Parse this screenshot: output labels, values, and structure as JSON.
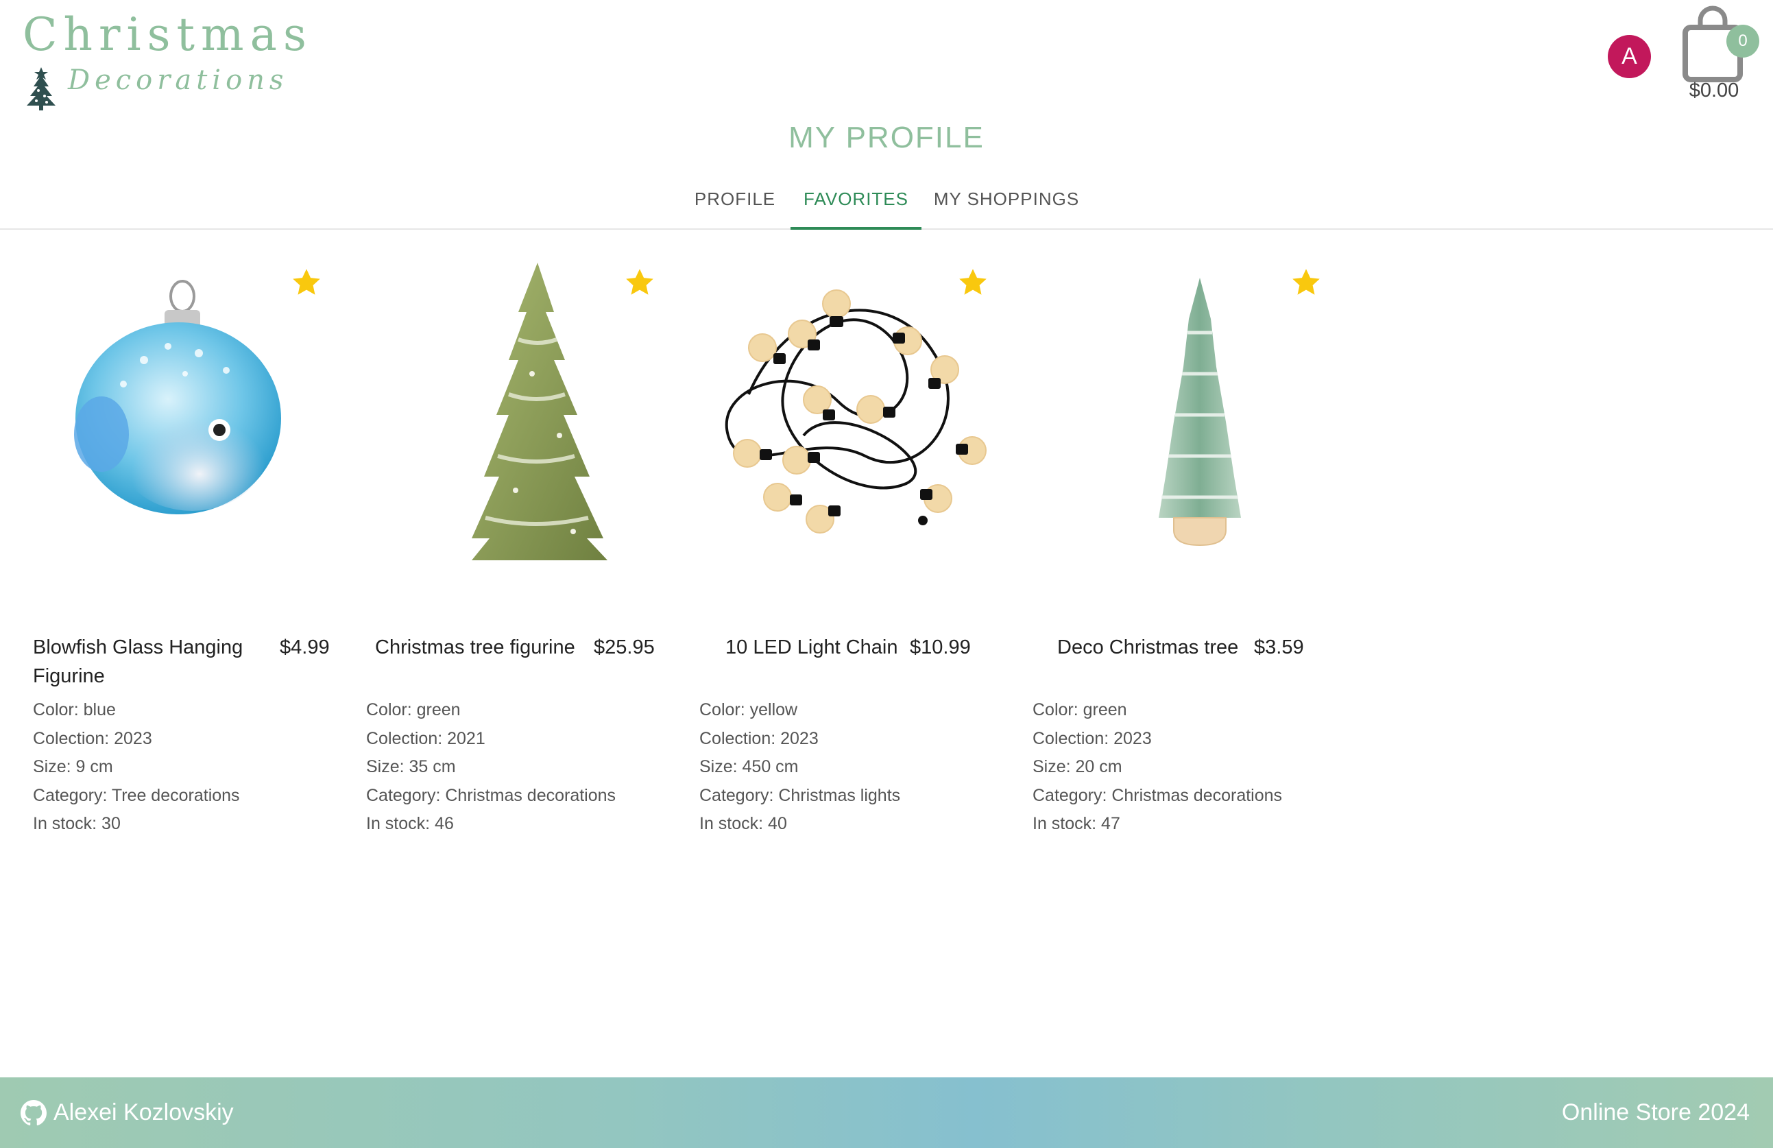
{
  "header": {
    "logo": {
      "title": "Christmas",
      "subtitle": "Decorations",
      "icon": "christmas-tree-icon"
    },
    "avatar_letter": "A",
    "avatar_color": "#c2185b",
    "cart": {
      "count": "0",
      "total": "$0.00",
      "icon": "shopping-bag-icon"
    }
  },
  "page_title": "MY PROFILE",
  "tabs": [
    {
      "label": "PROFILE",
      "active": false
    },
    {
      "label": "FAVORITES",
      "active": true
    },
    {
      "label": "MY SHOPPINGS",
      "active": false
    }
  ],
  "products": [
    {
      "name_line1": "Blowfish Glass Hanging",
      "name_line2": "Figurine",
      "price": "$4.99",
      "color": "Color: blue",
      "collection": "Colection: 2023",
      "size": "Size: 9 cm",
      "category": "Category: Tree decorations",
      "stock": "In stock: 30",
      "favorite": true
    },
    {
      "name_line1": "Christmas tree figurine",
      "price": "$25.95",
      "color": "Color: green",
      "collection": "Colection: 2021",
      "size": "Size: 35 cm",
      "category": "Category: Christmas decorations",
      "stock": "In stock: 46",
      "favorite": true
    },
    {
      "name_line1": "10 LED Light Chain",
      "price": "$10.99",
      "color": "Color: yellow",
      "collection": "Colection: 2023",
      "size": "Size: 450 cm",
      "category": "Category: Christmas lights",
      "stock": "In stock: 40",
      "favorite": true
    },
    {
      "name_line1": "Deco Christmas tree",
      "price": "$3.59",
      "color": "Color: green",
      "collection": "Colection: 2023",
      "size": "Size: 20 cm",
      "category": "Category: Christmas decorations",
      "stock": "In stock: 47",
      "favorite": true
    }
  ],
  "footer": {
    "author": "Alexei Kozlovskiy",
    "author_icon": "github-icon",
    "right_text": "Online Store 2024"
  },
  "colors": {
    "accent": "#8fbf9d",
    "active_tab": "#2e8b57",
    "star": "#f9c80e"
  }
}
